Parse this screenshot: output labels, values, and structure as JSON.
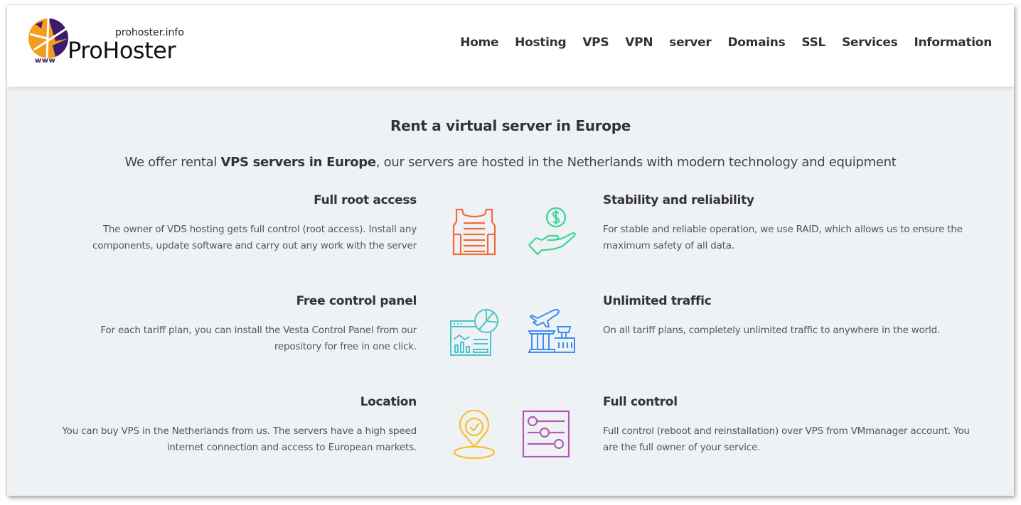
{
  "header": {
    "logo": {
      "domain": "prohoster.info",
      "name": "ProHoster",
      "www": "www"
    },
    "nav": [
      "Home",
      "Hosting",
      "VPS",
      "VPN",
      "server",
      "Domains",
      "SSL",
      "Services",
      "Information"
    ]
  },
  "main": {
    "title": "Rent a virtual server in Europe",
    "subtitle": {
      "prefix": "We offer rental ",
      "bold": "VPS servers in Europe",
      "suffix": ", our servers are hosted in the Netherlands with modern technology and equipment"
    },
    "features_left": [
      {
        "title": "Full root access",
        "text": "The owner of VDS hosting gets full control (root access). Install any components, update software and carry out any work with the server",
        "icon": "vest-icon",
        "color": "#f26b3a"
      },
      {
        "title": "Free control panel",
        "text": "For each tariff plan, you can install the Vesta Control Panel from our repository for free in one click.",
        "icon": "dashboard-chart-icon",
        "color": "#4ec3c9"
      },
      {
        "title": "Location",
        "text": "You can buy VPS in the Netherlands from us. The servers have a high speed internet connection and access to European markets.",
        "icon": "location-check-icon",
        "color": "#f7c02b"
      }
    ],
    "features_right": [
      {
        "title": "Stability and reliability",
        "text": "For stable and reliable operation, we use RAID, which allows us to ensure the maximum safety of all data.",
        "icon": "hand-dollar-icon",
        "color": "#3ed49a"
      },
      {
        "title": "Unlimited traffic",
        "text": "On all tariff plans, completely unlimited traffic to anywhere in the world.",
        "icon": "airport-plane-icon",
        "color": "#3d8ef0"
      },
      {
        "title": "Full control",
        "text": "Full control (reboot and reinstallation) over VPS from VMmanager account. You are the full owner of your service.",
        "icon": "sliders-icon",
        "color": "#b55bb5"
      }
    ]
  }
}
